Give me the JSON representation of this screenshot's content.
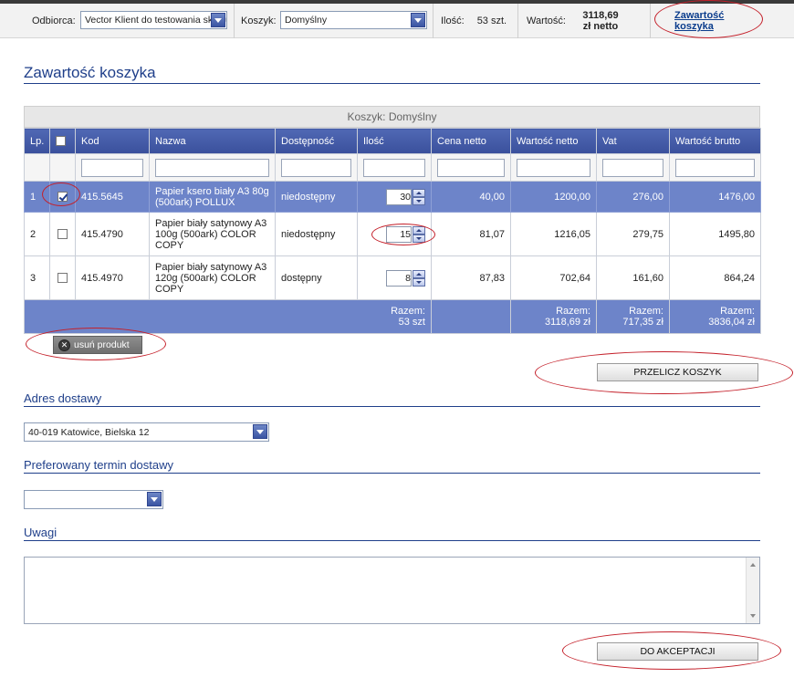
{
  "topbar": {
    "recipient_label": "Odbiorca:",
    "recipient_value": "Vector Klient do testowania sklepu",
    "cart_label": "Koszyk:",
    "cart_value": "Domyślny",
    "qty_label": "Ilość:",
    "qty_value": "53 szt.",
    "value_label": "Wartość:",
    "value_amount": "3118,69",
    "value_unit": "zł netto",
    "cart_link_line1": "Zawartość",
    "cart_link_line2": "koszyka"
  },
  "page_title": "Zawartość koszyka",
  "cart": {
    "caption": "Koszyk: Domyślny",
    "columns": [
      "Lp.",
      "",
      "Kod",
      "Nazwa",
      "Dostępność",
      "Ilość",
      "Cena netto",
      "Wartość netto",
      "Vat",
      "Wartość brutto"
    ],
    "rows": [
      {
        "lp": "1",
        "checked": true,
        "code": "415.5645",
        "name": "Papier ksero biały A3 80g (500ark) POLLUX",
        "availability": "niedostępny",
        "qty": "30",
        "price": "40,00",
        "net": "1200,00",
        "vat": "276,00",
        "gross": "1476,00"
      },
      {
        "lp": "2",
        "checked": false,
        "code": "415.4790",
        "name": "Papier biały satynowy A3 100g (500ark) COLOR COPY",
        "availability": "niedostępny",
        "qty": "15",
        "price": "81,07",
        "net": "1216,05",
        "vat": "279,75",
        "gross": "1495,80"
      },
      {
        "lp": "3",
        "checked": false,
        "code": "415.4970",
        "name": "Papier biały satynowy A3 120g (500ark) COLOR COPY",
        "availability": "dostępny",
        "qty": "8",
        "price": "87,83",
        "net": "702,64",
        "vat": "161,60",
        "gross": "864,24"
      }
    ],
    "totals": {
      "label": "Razem:",
      "qty": "53 szt",
      "net": "3118,69 zł",
      "vat": "717,35 zł",
      "gross": "3836,04 zł"
    }
  },
  "buttons": {
    "remove_product": "usuń produkt",
    "recalculate": "PRZELICZ KOSZYK",
    "accept": "DO AKCEPTACJI"
  },
  "delivery": {
    "address_heading": "Adres dostawy",
    "address_value": "40-019 Katowice, Bielska 12",
    "term_heading": "Preferowany termin dostawy",
    "term_value": "",
    "notes_heading": "Uwagi"
  },
  "colors": {
    "header_blue": "#3a509c",
    "row_highlight": "#6d84c9",
    "heading_text": "#1f3f8a",
    "annotation_red": "#c4202a"
  }
}
